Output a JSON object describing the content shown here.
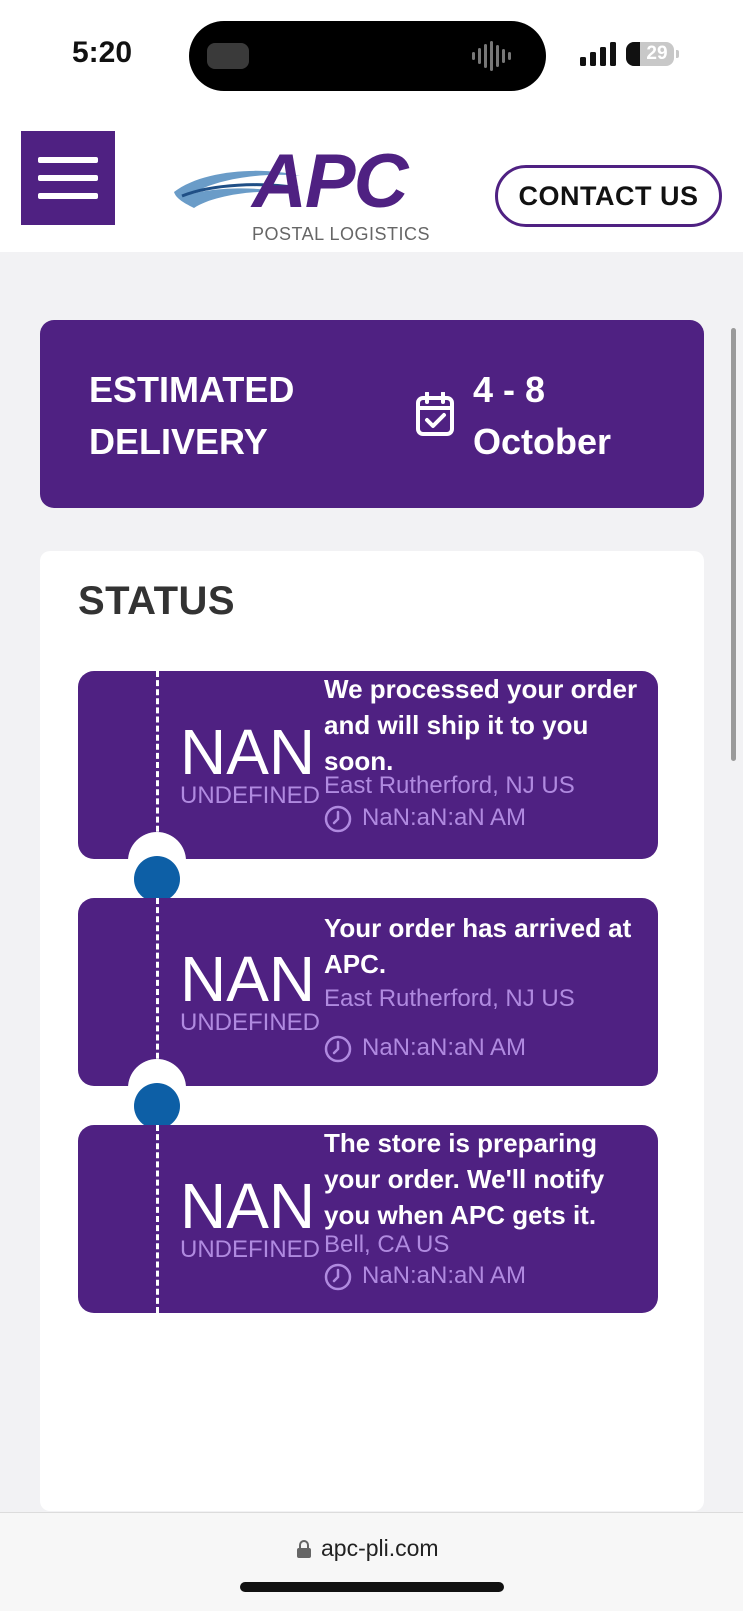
{
  "status_bar": {
    "time": "5:20",
    "battery": "29"
  },
  "header": {
    "logo": {
      "name": "APC",
      "subtitle": "POSTAL LOGISTICS"
    },
    "contact_label": "CONTACT US"
  },
  "delivery": {
    "label": "ESTIMATED DELIVERY",
    "date": "4 - 8 October",
    "icon": "calendar-check-icon"
  },
  "status": {
    "title": "STATUS",
    "events": [
      {
        "day": "NAN",
        "month": "UNDEFINED",
        "description": "We processed your order and will ship it to you soon.",
        "location": "East Rutherford, NJ US",
        "time": "NaN:aN:aN AM"
      },
      {
        "day": "NAN",
        "month": "UNDEFINED",
        "description": "Your order has arrived at APC.",
        "location": "East Rutherford, NJ US",
        "time": "NaN:aN:aN AM"
      },
      {
        "day": "NAN",
        "month": "UNDEFINED",
        "description": "The store is preparing your order. We'll notify you when APC gets it.",
        "location": "Bell, CA US",
        "time": "NaN:aN:aN AM"
      }
    ]
  },
  "browser": {
    "url": "apc-pli.com"
  },
  "colors": {
    "brand_purple": "#4f2182",
    "muted_purple": "#b08ae0",
    "dot_blue": "#0d5fa6"
  }
}
